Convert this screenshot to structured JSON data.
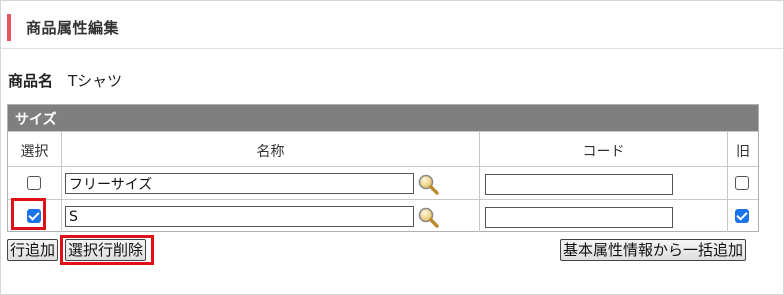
{
  "header": {
    "title": "商品属性編集",
    "accent_color": "#e8545f"
  },
  "product": {
    "label": "商品名",
    "value": "Tシャツ"
  },
  "size_panel": {
    "title": "サイズ",
    "columns": {
      "select": "選択",
      "name": "名称",
      "code": "コード",
      "old": "旧"
    },
    "rows": [
      {
        "name": "フリーサイズ",
        "code": "",
        "selected": false,
        "old": false
      },
      {
        "name": "S",
        "code": "",
        "selected": true,
        "old": false
      }
    ]
  },
  "buttons": {
    "add_row": "行追加",
    "delete_selected": "選択行削除",
    "bulk_add": "基本属性情報から一括追加"
  },
  "highlight_color": "#e0101a",
  "icons": {
    "lookup": "magnifier-icon"
  }
}
